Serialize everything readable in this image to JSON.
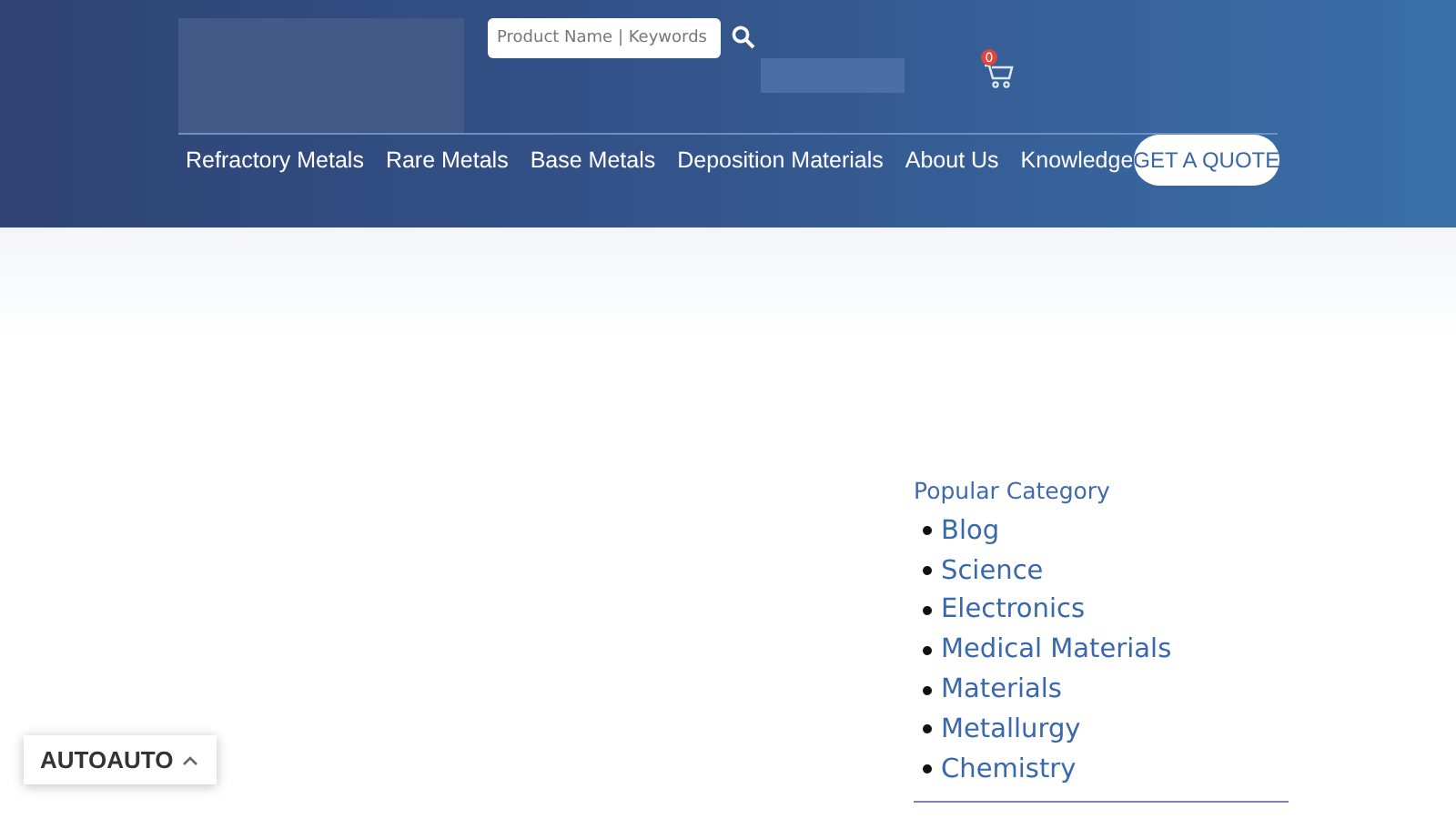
{
  "header": {
    "search": {
      "placeholder": "Product Name | Keywords"
    },
    "cart": {
      "count": "0"
    },
    "nav": [
      "Refractory Metals",
      "Rare Metals",
      "Base Metals",
      "Deposition Materials",
      "About Us",
      "Knowledge"
    ],
    "cta": "GET A QUOTE"
  },
  "sidebar": {
    "title": "Popular Category",
    "items": [
      "Blog",
      "Science",
      "Electronics",
      "Medical Materials",
      "Materials",
      "Metallurgy",
      "Chemistry"
    ]
  },
  "widget": {
    "labels": [
      "AUTO",
      "AUTO"
    ]
  }
}
